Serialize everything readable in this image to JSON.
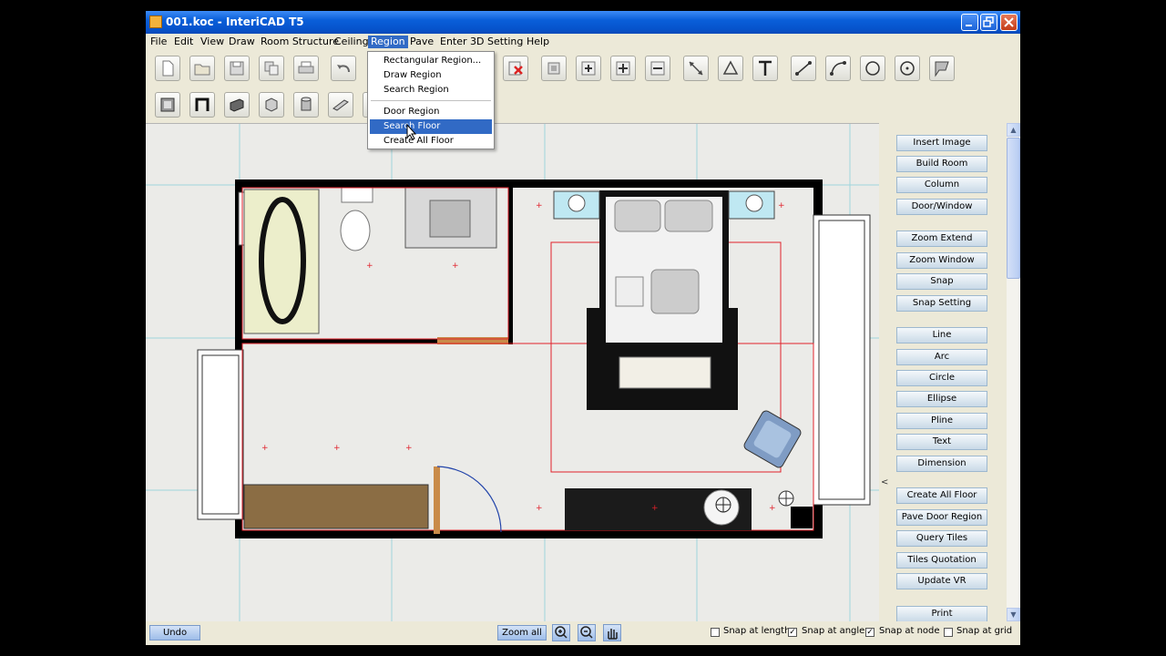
{
  "window": {
    "title": "001.koc - InteriCAD T5",
    "minimize": "0",
    "maximize": "1",
    "close": "r"
  },
  "menu": [
    "File",
    "Edit",
    "View",
    "Draw",
    "Room Structure",
    "Ceiling",
    "Region",
    "Pave",
    "Enter 3D",
    "Setting",
    "Help"
  ],
  "region_menu": {
    "items": [
      "Rectangular Region...",
      "Draw Region",
      "Search Region",
      "Door Region",
      "Search Floor",
      "Create All Floor"
    ],
    "highlighted": "Search Floor"
  },
  "toolbar_row1": [
    "new-icon",
    "open-icon",
    "save-icon",
    "copy-icon",
    "print-icon",
    "undo-icon",
    "delete-icon",
    "dimension-icon",
    "add-icon",
    "zoom-in-icon",
    "zoom-out-icon",
    "measure-icon",
    "angle-icon",
    "text-icon",
    "line-icon",
    "arc-icon",
    "circle-icon",
    "point-circle-icon",
    "flag-icon"
  ],
  "toolbar_row2": [
    "window-icon",
    "door-icon",
    "wall-icon",
    "box-icon",
    "cylinder-icon",
    "beam-icon"
  ],
  "right_panel": {
    "buttons": [
      "Insert Image",
      "Build Room",
      "Column",
      "Door/Window",
      "Zoom Extend",
      "Zoom Window",
      "Snap",
      "Snap Setting",
      "Line",
      "Arc",
      "Circle",
      "Ellipse",
      "Pline",
      "Text",
      "Dimension",
      "Create All Floor",
      "Pave Door Region",
      "Query Tiles",
      "Tiles Quotation",
      "Update VR",
      "Print"
    ],
    "collapse": "<"
  },
  "statusbar": {
    "undo": "Undo",
    "zoom_all": "Zoom all",
    "snaps": [
      {
        "label": "Snap at length",
        "checked": false
      },
      {
        "label": "Snap at angle",
        "checked": true
      },
      {
        "label": "Snap at node",
        "checked": true
      },
      {
        "label": "Snap at grid",
        "checked": false
      }
    ]
  },
  "colors": {
    "titlebar": "#0a5fd9",
    "menu_highlight": "#316ac5",
    "wall": "#000000",
    "region_line": "#e0202a",
    "grid": "#9fd6dc"
  }
}
